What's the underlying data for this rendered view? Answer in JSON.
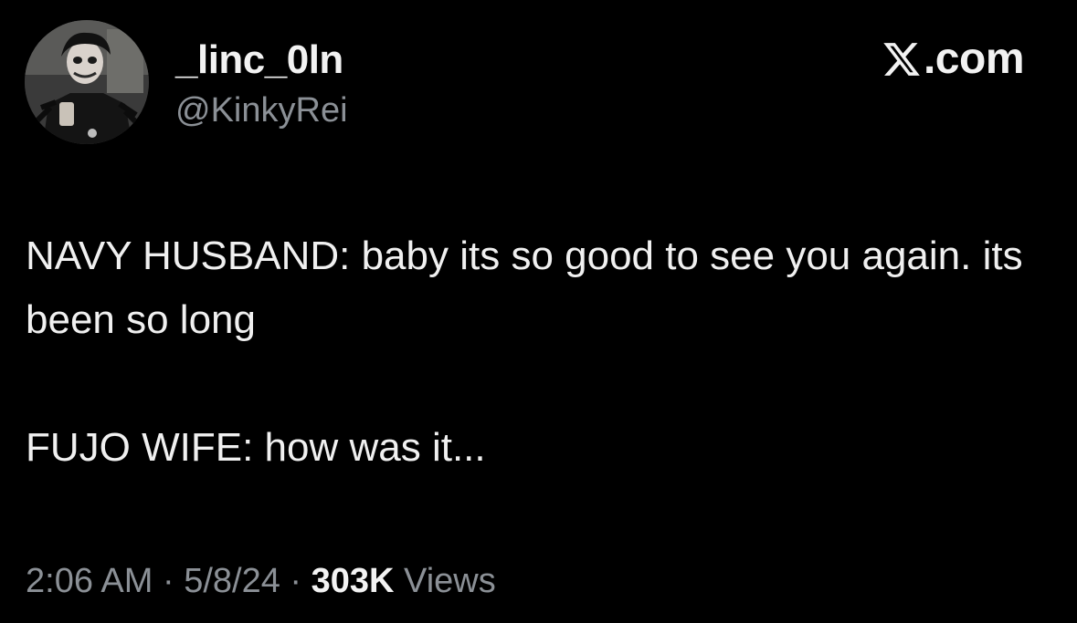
{
  "author": {
    "display_name": "_linc_0ln",
    "handle": "@KinkyRei"
  },
  "brand": {
    "text": ".com",
    "icon": "x-logo-icon"
  },
  "tweet": {
    "line1": "NAVY HUSBAND: baby its so good to see you again. its been so long",
    "line2": "FUJO WIFE: how was it..."
  },
  "meta": {
    "time": "2:06 AM",
    "separator1": " · ",
    "date": "5/8/24",
    "separator2": " · ",
    "view_count": "303K",
    "views_label": " Views"
  },
  "colors": {
    "background": "#000000",
    "primary_text": "#e7e9ea",
    "secondary_text": "#8b9096"
  }
}
